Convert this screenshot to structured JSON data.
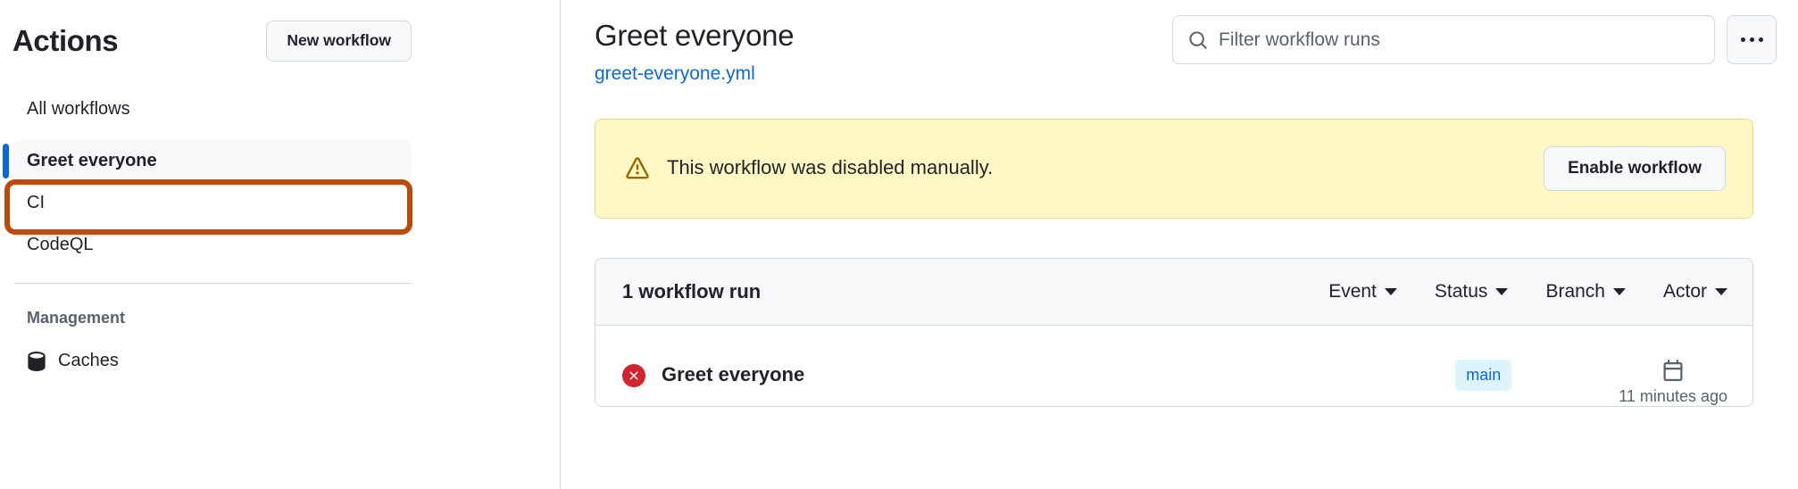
{
  "sidebar": {
    "title": "Actions",
    "new_workflow_label": "New workflow",
    "workflows": [
      {
        "label": "All workflows",
        "selected": false
      },
      {
        "label": "Greet everyone",
        "selected": true
      },
      {
        "label": "CI",
        "selected": false
      },
      {
        "label": "CodeQL",
        "selected": false
      }
    ],
    "management_heading": "Management",
    "management_items": [
      {
        "label": "Caches",
        "icon": "database-icon"
      }
    ],
    "selected_indicator_color": "#0969da",
    "annotation_box_color": "#bb4a0c"
  },
  "main": {
    "workflow_title": "Greet everyone",
    "workflow_file": "greet-everyone.yml",
    "workflow_file_color": "#0969da",
    "search": {
      "placeholder": "Filter workflow runs",
      "value": "",
      "icon": "search-icon"
    },
    "kebab_menu": {
      "icon": "kebab-horizontal-icon",
      "label": "..."
    },
    "banner": {
      "icon": "alert-triangle-icon",
      "text": "This workflow was disabled manually.",
      "button_label": "Enable workflow",
      "background_color": "#fff8c5",
      "icon_color": "#9a6700"
    },
    "runs": {
      "count_label": "1 workflow run",
      "filters": [
        {
          "label": "Event"
        },
        {
          "label": "Status"
        },
        {
          "label": "Branch"
        },
        {
          "label": "Actor"
        }
      ],
      "rows": [
        {
          "status_icon": "failure-x-icon",
          "status_color": "#d1242f",
          "name": "Greet everyone",
          "branch": "main",
          "time_icon": "calendar-icon",
          "time_text": "11 minutes ago"
        }
      ]
    }
  }
}
